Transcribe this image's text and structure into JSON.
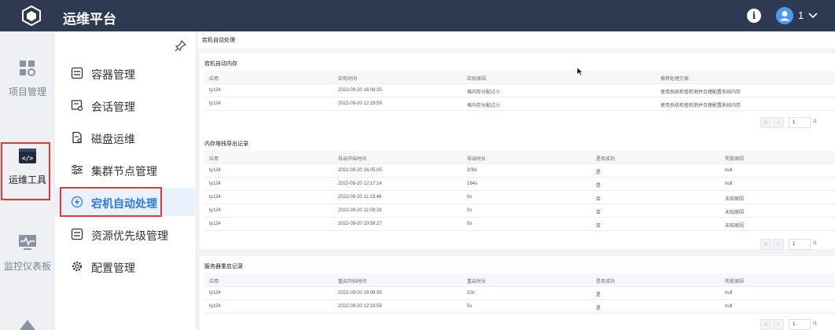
{
  "header": {
    "title": "运维平台",
    "user": "1"
  },
  "rail": {
    "items": [
      {
        "label": "项目管理"
      },
      {
        "label": "运维工具"
      },
      {
        "label": "监控仪表板"
      }
    ]
  },
  "submenu": {
    "items": [
      {
        "label": "容器管理"
      },
      {
        "label": "会话管理"
      },
      {
        "label": "磁盘运维"
      },
      {
        "label": "集群节点管理"
      },
      {
        "label": "宕机自动处理"
      },
      {
        "label": "资源优先级管理"
      },
      {
        "label": "配置管理"
      }
    ]
  },
  "page": {
    "title": "宕机自动处理"
  },
  "cards": {
    "memory": {
      "title": "宕机自动内存",
      "columns": [
        "应用",
        "宕机时间",
        "宕机原因",
        "推荐处理方案"
      ],
      "rows": [
        [
          "ty124",
          "2022-09-20 16:08:35",
          "堆内存分配过小",
          "使用系统检查检测并合理配置系统内存"
        ],
        [
          "ty124",
          "2022-09-20 12:19:59",
          "堆内存分配过小",
          "使用系统检查检测并合理配置系统内存"
        ]
      ],
      "pager": {
        "page": "1",
        "total": "/1"
      }
    },
    "export": {
      "title": "内存堆栈导出记录",
      "columns": [
        "应用",
        "导出开始时间",
        "导出时长",
        "是否成功",
        "失败原因"
      ],
      "rows": [
        [
          "ty124",
          "2022-09-20 16:05:05",
          "208s",
          "是",
          "null"
        ],
        [
          "ty124",
          "2022-09-20 12:17:14",
          "164s",
          "是",
          "null"
        ],
        [
          "ty124",
          "2022-09-20 11:18:46",
          "0s",
          "否",
          "未知原因"
        ],
        [
          "ty124",
          "2022-09-20 11:08:33",
          "0s",
          "否",
          "未知原因"
        ],
        [
          "ty124",
          "2022-09-20 10:58:27",
          "0s",
          "否",
          "未知原因"
        ]
      ],
      "pager": {
        "page": "1",
        "total": "/1"
      }
    },
    "restart": {
      "title": "服务器重启记录",
      "columns": [
        "应用",
        "重启开始时间",
        "重启时长",
        "是否成功",
        "失败原因"
      ],
      "rows": [
        [
          "ty124",
          "2022-09-20 16:08:35",
          "10s",
          "是",
          "null"
        ],
        [
          "ty124",
          "2022-09-20 12:19:59",
          "5s",
          "是",
          "null"
        ]
      ],
      "pager": {
        "page": "1",
        "total": "/1"
      }
    }
  },
  "icons": {
    "logo": "cube-logo-icon",
    "info": "info-icon",
    "user": "user-avatar-icon"
  },
  "colors": {
    "topbar": "#2d3a52",
    "accent": "#2f7be5",
    "highlight_box": "#e53935"
  }
}
